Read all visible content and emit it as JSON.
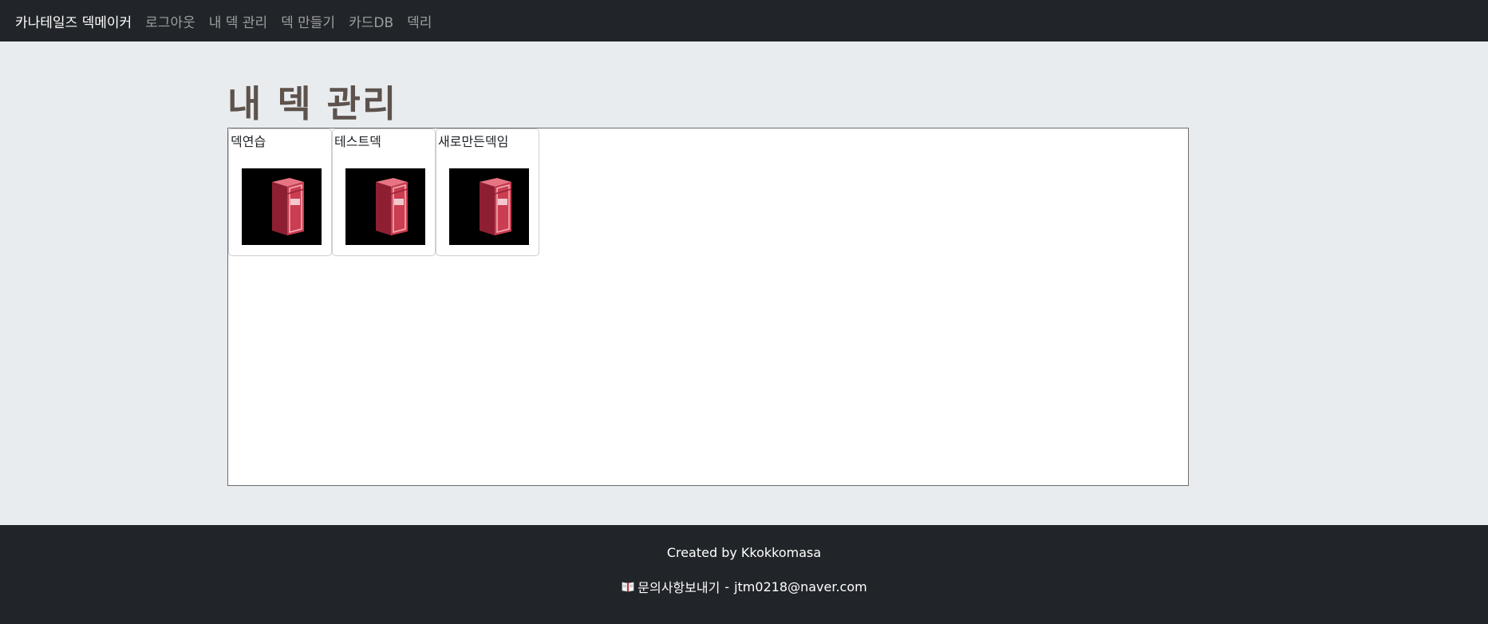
{
  "navbar": {
    "brand": "카나테일즈 덱메이커",
    "links": [
      "로그아웃",
      "내 덱 관리",
      "덱 만들기",
      "카드DB",
      "덱리"
    ]
  },
  "main": {
    "title": "내 덱 관리",
    "decks": [
      {
        "name": "덱연습",
        "image_icon": "deck-box-icon"
      },
      {
        "name": "테스트덱",
        "image_icon": "deck-box-icon"
      },
      {
        "name": "새로만든덱임",
        "image_icon": "deck-box-icon"
      }
    ]
  },
  "footer": {
    "credit": "Created by Kkokkomasa",
    "contact_icon": "open-book-icon",
    "contact_label": "문의사항보내기",
    "contact_separator": "-",
    "contact_email": "jtm0218@naver.com"
  },
  "colors": {
    "navbar_bg": "#212529",
    "page_bg": "#e9ecef",
    "title_color": "#5d524c",
    "deck_box_red": "#c43c4f"
  }
}
